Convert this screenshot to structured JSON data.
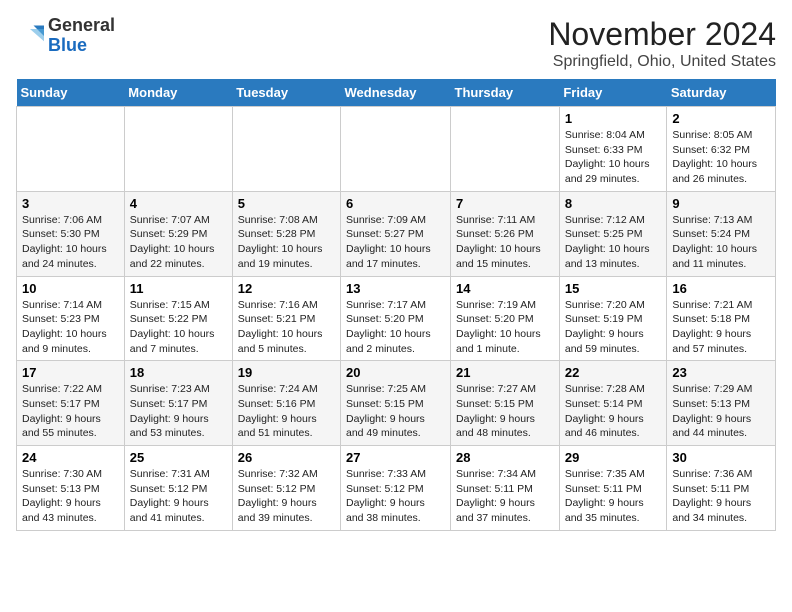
{
  "header": {
    "logo_general": "General",
    "logo_blue": "Blue",
    "month_title": "November 2024",
    "location": "Springfield, Ohio, United States"
  },
  "days_of_week": [
    "Sunday",
    "Monday",
    "Tuesday",
    "Wednesday",
    "Thursday",
    "Friday",
    "Saturday"
  ],
  "weeks": [
    [
      {
        "day": "",
        "info": ""
      },
      {
        "day": "",
        "info": ""
      },
      {
        "day": "",
        "info": ""
      },
      {
        "day": "",
        "info": ""
      },
      {
        "day": "",
        "info": ""
      },
      {
        "day": "1",
        "info": "Sunrise: 8:04 AM\nSunset: 6:33 PM\nDaylight: 10 hours and 29 minutes."
      },
      {
        "day": "2",
        "info": "Sunrise: 8:05 AM\nSunset: 6:32 PM\nDaylight: 10 hours and 26 minutes."
      }
    ],
    [
      {
        "day": "3",
        "info": "Sunrise: 7:06 AM\nSunset: 5:30 PM\nDaylight: 10 hours and 24 minutes."
      },
      {
        "day": "4",
        "info": "Sunrise: 7:07 AM\nSunset: 5:29 PM\nDaylight: 10 hours and 22 minutes."
      },
      {
        "day": "5",
        "info": "Sunrise: 7:08 AM\nSunset: 5:28 PM\nDaylight: 10 hours and 19 minutes."
      },
      {
        "day": "6",
        "info": "Sunrise: 7:09 AM\nSunset: 5:27 PM\nDaylight: 10 hours and 17 minutes."
      },
      {
        "day": "7",
        "info": "Sunrise: 7:11 AM\nSunset: 5:26 PM\nDaylight: 10 hours and 15 minutes."
      },
      {
        "day": "8",
        "info": "Sunrise: 7:12 AM\nSunset: 5:25 PM\nDaylight: 10 hours and 13 minutes."
      },
      {
        "day": "9",
        "info": "Sunrise: 7:13 AM\nSunset: 5:24 PM\nDaylight: 10 hours and 11 minutes."
      }
    ],
    [
      {
        "day": "10",
        "info": "Sunrise: 7:14 AM\nSunset: 5:23 PM\nDaylight: 10 hours and 9 minutes."
      },
      {
        "day": "11",
        "info": "Sunrise: 7:15 AM\nSunset: 5:22 PM\nDaylight: 10 hours and 7 minutes."
      },
      {
        "day": "12",
        "info": "Sunrise: 7:16 AM\nSunset: 5:21 PM\nDaylight: 10 hours and 5 minutes."
      },
      {
        "day": "13",
        "info": "Sunrise: 7:17 AM\nSunset: 5:20 PM\nDaylight: 10 hours and 2 minutes."
      },
      {
        "day": "14",
        "info": "Sunrise: 7:19 AM\nSunset: 5:20 PM\nDaylight: 10 hours and 1 minute."
      },
      {
        "day": "15",
        "info": "Sunrise: 7:20 AM\nSunset: 5:19 PM\nDaylight: 9 hours and 59 minutes."
      },
      {
        "day": "16",
        "info": "Sunrise: 7:21 AM\nSunset: 5:18 PM\nDaylight: 9 hours and 57 minutes."
      }
    ],
    [
      {
        "day": "17",
        "info": "Sunrise: 7:22 AM\nSunset: 5:17 PM\nDaylight: 9 hours and 55 minutes."
      },
      {
        "day": "18",
        "info": "Sunrise: 7:23 AM\nSunset: 5:17 PM\nDaylight: 9 hours and 53 minutes."
      },
      {
        "day": "19",
        "info": "Sunrise: 7:24 AM\nSunset: 5:16 PM\nDaylight: 9 hours and 51 minutes."
      },
      {
        "day": "20",
        "info": "Sunrise: 7:25 AM\nSunset: 5:15 PM\nDaylight: 9 hours and 49 minutes."
      },
      {
        "day": "21",
        "info": "Sunrise: 7:27 AM\nSunset: 5:15 PM\nDaylight: 9 hours and 48 minutes."
      },
      {
        "day": "22",
        "info": "Sunrise: 7:28 AM\nSunset: 5:14 PM\nDaylight: 9 hours and 46 minutes."
      },
      {
        "day": "23",
        "info": "Sunrise: 7:29 AM\nSunset: 5:13 PM\nDaylight: 9 hours and 44 minutes."
      }
    ],
    [
      {
        "day": "24",
        "info": "Sunrise: 7:30 AM\nSunset: 5:13 PM\nDaylight: 9 hours and 43 minutes."
      },
      {
        "day": "25",
        "info": "Sunrise: 7:31 AM\nSunset: 5:12 PM\nDaylight: 9 hours and 41 minutes."
      },
      {
        "day": "26",
        "info": "Sunrise: 7:32 AM\nSunset: 5:12 PM\nDaylight: 9 hours and 39 minutes."
      },
      {
        "day": "27",
        "info": "Sunrise: 7:33 AM\nSunset: 5:12 PM\nDaylight: 9 hours and 38 minutes."
      },
      {
        "day": "28",
        "info": "Sunrise: 7:34 AM\nSunset: 5:11 PM\nDaylight: 9 hours and 37 minutes."
      },
      {
        "day": "29",
        "info": "Sunrise: 7:35 AM\nSunset: 5:11 PM\nDaylight: 9 hours and 35 minutes."
      },
      {
        "day": "30",
        "info": "Sunrise: 7:36 AM\nSunset: 5:11 PM\nDaylight: 9 hours and 34 minutes."
      }
    ]
  ]
}
